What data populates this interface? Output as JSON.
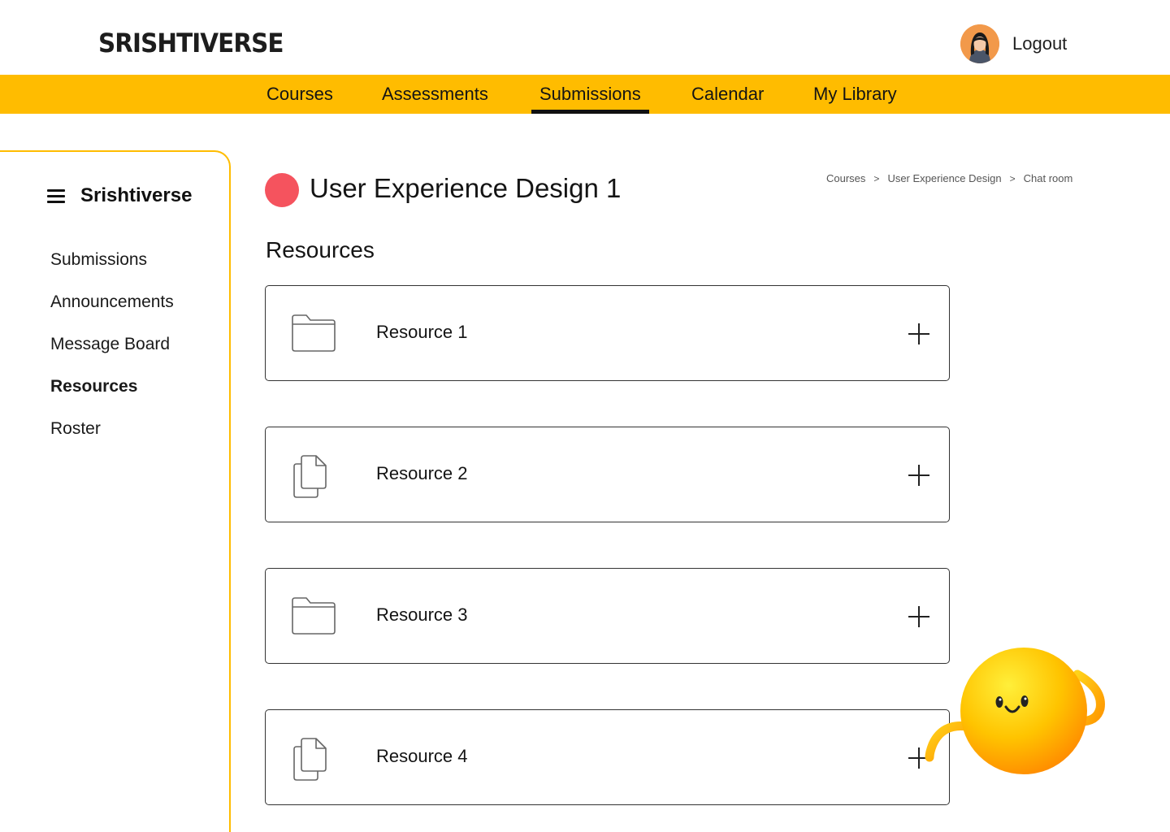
{
  "header": {
    "logo": "SRISHTIVERSE",
    "logout_label": "Logout",
    "avatar_icon": "user-avatar"
  },
  "nav": {
    "items": [
      {
        "label": "Courses"
      },
      {
        "label": "Assessments"
      },
      {
        "label": "Submissions",
        "active": true
      },
      {
        "label": "Calendar"
      },
      {
        "label": "My Library"
      }
    ]
  },
  "sidebar": {
    "menu_icon": "hamburger-icon",
    "title": "Srishtiverse",
    "items": [
      {
        "label": "Submissions"
      },
      {
        "label": "Announcements"
      },
      {
        "label": "Message Board"
      },
      {
        "label": "Resources",
        "active": true
      },
      {
        "label": "Roster"
      }
    ]
  },
  "course": {
    "title": "User Experience Design 1",
    "dot_color": "#f5535e"
  },
  "breadcrumb": [
    "Courses",
    "User Experience Design",
    "Chat room"
  ],
  "section": {
    "title": "Resources"
  },
  "resources": [
    {
      "label": "Resource 1",
      "icon": "folder-icon"
    },
    {
      "label": "Resource 2",
      "icon": "copy-icon"
    },
    {
      "label": "Resource 3",
      "icon": "folder-icon"
    },
    {
      "label": "Resource 4",
      "icon": "copy-icon"
    }
  ],
  "colors": {
    "accent": "#ffbc00",
    "course_dot": "#f5535e",
    "mascot": "#ffb000"
  }
}
